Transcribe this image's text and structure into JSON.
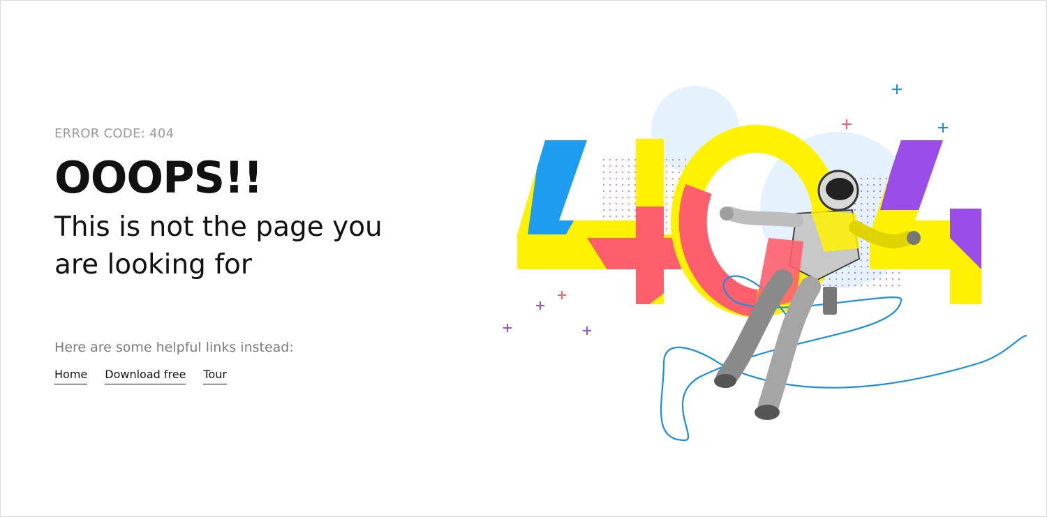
{
  "error": {
    "code_text": "ERROR CODE: 404"
  },
  "heading": {
    "title": "OOOPS!!",
    "subtitle": "This is not the page you are looking for"
  },
  "help": {
    "intro": "Here are some helpful links instead:",
    "links": [
      {
        "label": "Home"
      },
      {
        "label": "Download free"
      },
      {
        "label": "Tour"
      }
    ]
  },
  "illustration": {
    "digits": [
      "4",
      "0",
      "4"
    ],
    "colors": {
      "yellow": "#fff200",
      "blue": "#1e9cf0",
      "coral": "#ff5f6d",
      "purple": "#9b4dea",
      "light_blue": "#dff0fb",
      "line_blue": "#1a8ee0"
    },
    "figure": "astronaut"
  }
}
